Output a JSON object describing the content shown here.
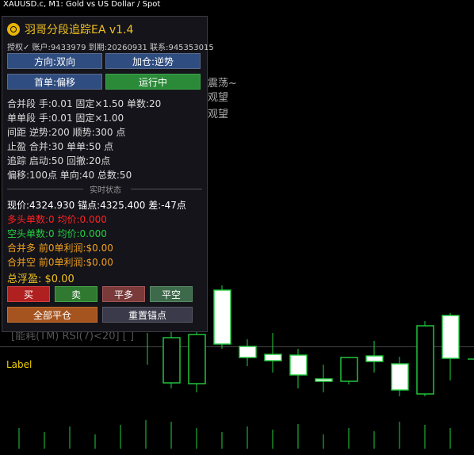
{
  "chart": {
    "symbol_line": "XAUUSD.c, M1:  Gold vs US Dollar / Spot",
    "overlay_label": "Label",
    "bg_text_1": "震荡~",
    "bg_text_2": "观望",
    "bg_text_3": "观望",
    "bg_text_4": "[能耗(TM) RSI(7)<20] [ ]",
    "candle_color": "#22d040"
  },
  "panel": {
    "title": "羽哥分段追踪EA v1.4",
    "info": "授权✓ 账户:9433979 到期:20260931 联系:945353015",
    "btn_direction": "方向:双向",
    "btn_add": "加仓:逆势",
    "btn_first": "首单:偏移",
    "btn_running": "运行中",
    "merge_line": "合并段 手:0.01 固定×1.50 单数:20",
    "single_line": "单单段 手:0.01 固定×1.00",
    "spacing_line": "间距 逆势:200 顺势:300 点",
    "takeprofit_line": "止盈 合并:30 单单:50 点",
    "trail_line": "追踪 启动:50 回撤:20点",
    "offset_line": "偏移:100点 单向:40 总数:50",
    "realtime_label": "实时状态",
    "price_line": "现价:4324.930 锚点:4325.400 差:-47点",
    "long_line": "多头单数:0   均价:0.000",
    "short_line": "空头单数:0   均价:0.000",
    "merge_long_line": "合并多 前0单利润:$0.00",
    "merge_short_line": "合并空 前0单利润:$0.00",
    "total_float": "总浮盈: $0.00",
    "btn_buy": "买",
    "btn_sell": "卖",
    "btn_close_long": "平多",
    "btn_close_short": "平空",
    "btn_close_all": "全部平仓",
    "btn_reset_anchor": "重置锚点"
  }
}
